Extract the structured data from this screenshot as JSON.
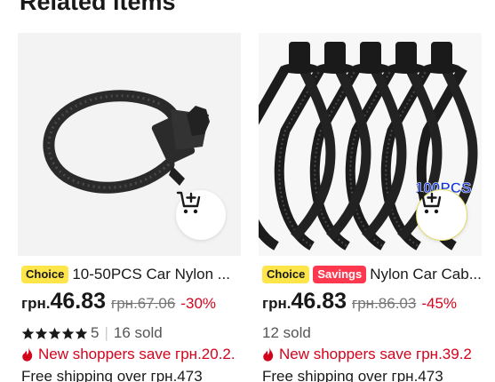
{
  "section": {
    "title": "Related items"
  },
  "products": [
    {
      "badges": [
        "Choice"
      ],
      "title": "10-50PCS Car Nylon ...",
      "currency": "грн.",
      "price": "46.83",
      "old_price": "грн.67.06",
      "discount": "-30%",
      "rating_value": "5",
      "sold": "16 sold",
      "promo": "New shoppers save грн.20.2.",
      "shipping": "Free shipping over грн.473"
    },
    {
      "badges": [
        "Choice",
        "Savings"
      ],
      "title": "Nylon Car Cab...",
      "currency": "грн.",
      "price": "46.83",
      "old_price": "грн.86.03",
      "discount": "-45%",
      "sold": "12 sold",
      "promo": "New shoppers save грн.39.2",
      "shipping": "Free shipping over грн.473",
      "image_overlay_text": "100PCS"
    }
  ],
  "colors": {
    "accent_red": "#d3031c",
    "choice_yellow": "#fde54a",
    "savings_red": "#fd384f"
  }
}
